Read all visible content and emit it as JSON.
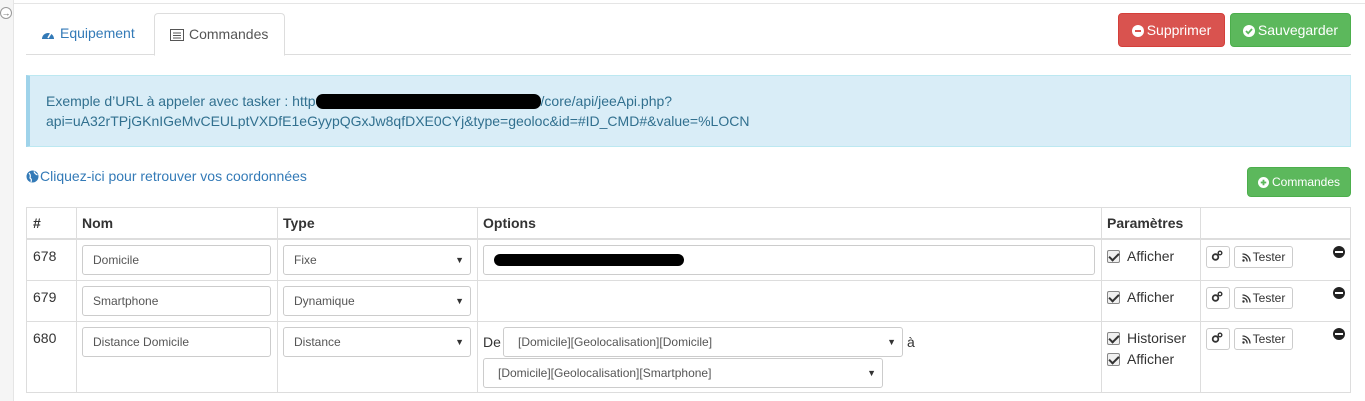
{
  "tabs": {
    "equipement": "Equipement",
    "commandes": "Commandes"
  },
  "actions": {
    "delete_label": "Supprimer",
    "save_label": "Sauvegarder",
    "add_commands_label": "Commandes"
  },
  "info": {
    "line1_prefix": "Exemple d’URL à appeler avec tasker : http",
    "line1_suffix": "/core/api/jeeApi.php?",
    "line2": "api=uA32rTPjGKnIGeMvCEULptVXDfE1eGyypQGxJw8qfDXE0CYj&type=geoloc&id=#ID_CMD#&value=%LOCN"
  },
  "coord_link": "Cliquez-ici pour retrouver vos coordonnées",
  "table": {
    "headers": {
      "id": "#",
      "nom": "Nom",
      "type": "Type",
      "options": "Options",
      "parametres": "Paramètres"
    },
    "rows": [
      {
        "id": "678",
        "nom": "Domicile",
        "type": "Fixe",
        "afficher": "Afficher",
        "config_label": "",
        "test_label": "Tester"
      },
      {
        "id": "679",
        "nom": "Smartphone",
        "type": "Dynamique",
        "afficher": "Afficher",
        "test_label": "Tester"
      },
      {
        "id": "680",
        "nom": "Distance Domicile",
        "type": "Distance",
        "historiser": "Historiser",
        "afficher": "Afficher",
        "test_label": "Tester",
        "de_label": "De",
        "a_label": "à",
        "from_select": "[Domicile][Geolocalisation][Domicile]",
        "to_select": "[Domicile][Geolocalisation][Smartphone]"
      }
    ]
  },
  "colors": {
    "primary": "#337ab7",
    "danger": "#d9534f",
    "success": "#5cb85c",
    "info_bg": "#d9edf7",
    "info_text": "#31708f"
  }
}
